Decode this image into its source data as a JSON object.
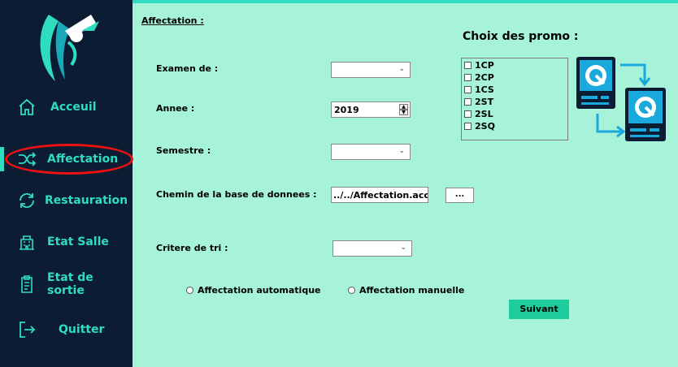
{
  "sidebar": {
    "items": [
      {
        "label": "Acceuil",
        "icon": "home-icon"
      },
      {
        "label": "Affectation",
        "icon": "shuffle-icon"
      },
      {
        "label": "Restauration",
        "icon": "refresh-icon"
      },
      {
        "label": "Etat Salle",
        "icon": "building-icon"
      },
      {
        "label": "Etat de sortie",
        "icon": "clipboard-icon"
      },
      {
        "label": "Quitter",
        "icon": "exit-icon"
      }
    ],
    "active": "Affectation"
  },
  "form": {
    "section_title": "Affectation :",
    "examen_label": "Examen de :",
    "annee_label": "Annee :",
    "annee_value": "2019",
    "semestre_label": "Semestre :",
    "chemin_label": "Chemin de la base de donnees :",
    "chemin_value": "../../Affectation.accdb",
    "browse_label": "...",
    "critere_label": "Critere de tri :",
    "radio_auto": "Affectation automatique",
    "radio_manuelle": "Affectation manuelle",
    "suivant_label": "Suivant"
  },
  "promo": {
    "title": "Choix des promo :",
    "items": [
      "1CP",
      "2CP",
      "1CS",
      "2ST",
      "2SL",
      "2SQ"
    ]
  },
  "colors": {
    "sidebar": "#0c1d33",
    "background": "#a6f3da",
    "accent": "#2fdcc0",
    "button": "#1fcd9c",
    "highlight": "#e11111"
  }
}
